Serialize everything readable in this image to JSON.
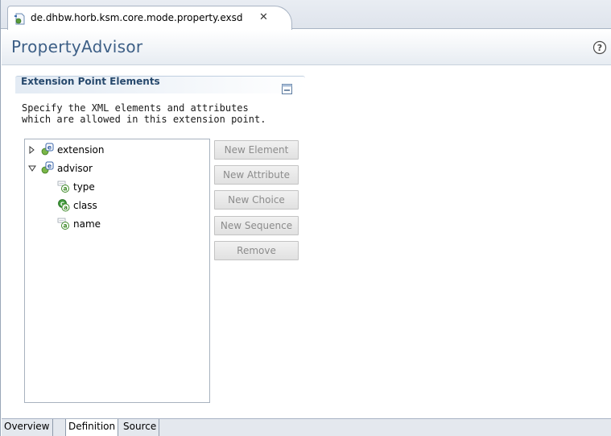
{
  "editor_tab": {
    "title": "de.dhbw.horb.ksm.core.mode.property.exsd",
    "close_glyph": "✕"
  },
  "header": {
    "title": "PropertyAdvisor",
    "help_icon": "help-icon"
  },
  "section": {
    "title": "Extension Point Elements",
    "description_line1": "Specify the XML elements and attributes",
    "description_line2": "which are allowed in this extension point."
  },
  "tree": {
    "nodes": [
      {
        "label": "extension",
        "kind": "element",
        "expanded": false,
        "level": 0
      },
      {
        "label": "advisor",
        "kind": "element",
        "expanded": true,
        "level": 0
      },
      {
        "label": "type",
        "kind": "attribute",
        "level": 1
      },
      {
        "label": "class",
        "kind": "attribute-class",
        "level": 1
      },
      {
        "label": "name",
        "kind": "attribute",
        "level": 1
      }
    ]
  },
  "buttons": {
    "new_element": "New Element",
    "new_attribute": "New Attribute",
    "new_choice": "New Choice",
    "new_sequence": "New Sequence",
    "remove": "Remove"
  },
  "bottom_tabs": {
    "overview": "Overview",
    "definition": "Definition",
    "source": "Source",
    "active": "Definition"
  },
  "colors": {
    "title_blue": "#3d5f86",
    "section_title": "#27496d",
    "disabled_text": "#8c8c8c"
  }
}
